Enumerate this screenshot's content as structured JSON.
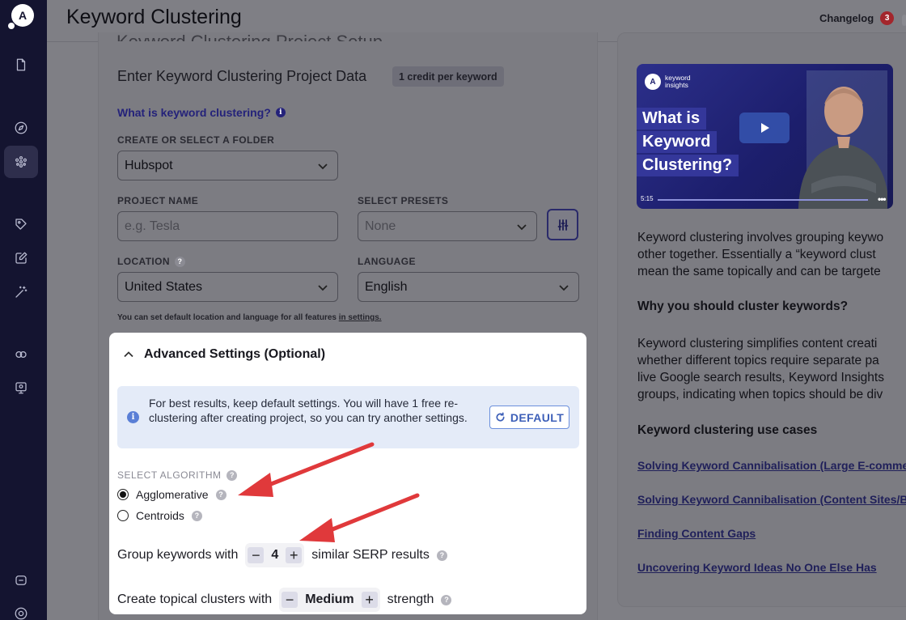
{
  "app": {
    "logo_text": "A"
  },
  "header": {
    "title": "Keyword Clustering",
    "changelog_label": "Changelog",
    "changelog_count": "3"
  },
  "form": {
    "cut_title": "Keyword Clustering Project Setup",
    "title": "Enter Keyword Clustering Project Data",
    "credit_badge": "1 credit per keyword",
    "what_link": "What is keyword clustering?",
    "folder_label": "CREATE OR SELECT A FOLDER",
    "folder_value": "Hubspot",
    "project_label": "PROJECT NAME",
    "project_placeholder": "e.g. Tesla",
    "presets_label": "SELECT PRESETS",
    "presets_value": "None",
    "location_label": "LOCATION",
    "location_value": "United States",
    "language_label": "LANGUAGE",
    "language_value": "English",
    "hint_text": "You can set default location and language for all features ",
    "hint_link": "in settings."
  },
  "advanced": {
    "title": "Advanced Settings (Optional)",
    "info_text": "For best results, keep default settings. You will have 1 free re-clustering after creating project, so you can try another settings.",
    "default_button": "DEFAULT",
    "algorithm_label": "SELECT ALGORITHM",
    "algorithms": [
      {
        "label": "Agglomerative",
        "selected": true
      },
      {
        "label": "Centroids",
        "selected": false
      }
    ],
    "group_prefix": "Group keywords with",
    "group_value": "4",
    "group_suffix": "similar SERP results",
    "topical_prefix": "Create topical clusters with",
    "topical_value": "Medium",
    "topical_suffix": "strength"
  },
  "right_panel": {
    "video": {
      "brand_line1": "keyword",
      "brand_line2": "insights",
      "title_lines": [
        "What is",
        "Keyword",
        "Clustering?"
      ],
      "duration": "5:15"
    },
    "intro_lines": [
      "Keyword clustering involves grouping keywo",
      "other together. Essentially a “keyword clust",
      "mean the same topically and can be targete"
    ],
    "why_heading": "Why you should cluster keywords?",
    "why_lines": [
      "Keyword clustering simplifies content creati",
      "whether different topics require separate pa",
      "live Google search results, Keyword Insights",
      "groups, indicating when topics should be div"
    ],
    "use_cases_heading": "Keyword clustering use cases",
    "links": [
      "Solving Keyword Cannibalisation (Large E-commer",
      "Solving Keyword Cannibalisation (Content Sites/BI",
      "Finding Content Gaps",
      "Uncovering Keyword Ideas No One Else Has"
    ]
  },
  "colors": {
    "accent": "#24227a",
    "arrow": "#e0393b",
    "info_bg": "#e4ebf8",
    "badge": "#a3262c"
  }
}
